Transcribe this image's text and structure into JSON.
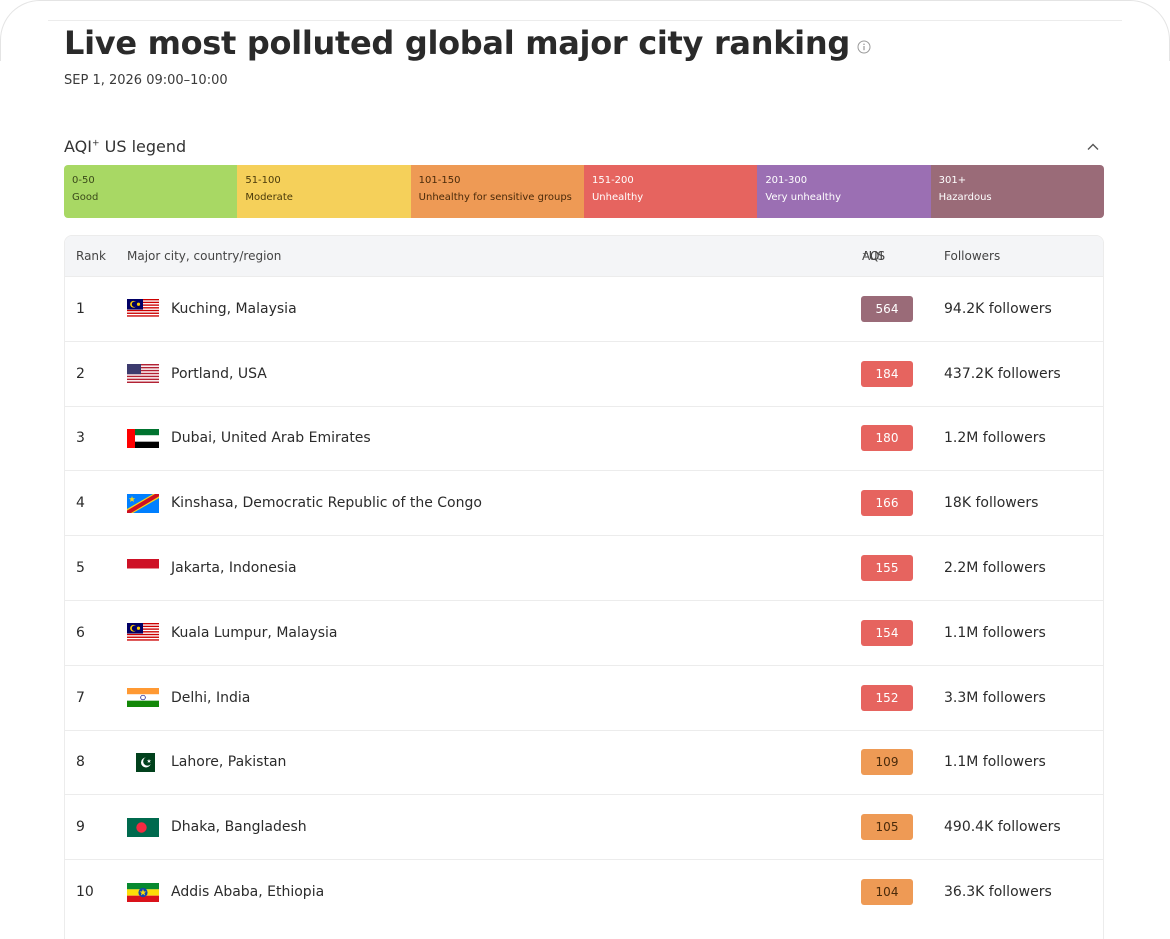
{
  "page": {
    "title": "Live most polluted global major city ranking",
    "timestamp": "SEP 1, 2026 09:00–10:00"
  },
  "icons": {
    "info": "info-icon",
    "collapse": "chevron-up-icon"
  },
  "legend": {
    "title": "AQI",
    "title_sup": "+",
    "title_suffix": " US legend",
    "segments": [
      {
        "range": "0-50",
        "label": "Good",
        "color": "#a8d864",
        "text_color": "#3a4a1a"
      },
      {
        "range": "51-100",
        "label": "Moderate",
        "color": "#f5d05a",
        "text_color": "#4a3a0a"
      },
      {
        "range": "101-150",
        "label": "Unhealthy for sensitive groups",
        "color": "#ee9a55",
        "text_color": "#4a2a0a"
      },
      {
        "range": "151-200",
        "label": "Unhealthy",
        "color": "#e6645f",
        "text_color": "#ffffff"
      },
      {
        "range": "201-300",
        "label": "Very unhealthy",
        "color": "#9b6fb3",
        "text_color": "#ffffff"
      },
      {
        "range": "301+",
        "label": "Hazardous",
        "color": "#9a6b78",
        "text_color": "#ffffff"
      }
    ]
  },
  "table": {
    "headers": {
      "rank": "Rank",
      "city": "Major city, country/region",
      "aqi": "AQI",
      "aqi_sup": "+",
      "aqi_suffix": " US",
      "followers": "Followers"
    },
    "rows": [
      {
        "rank": "1",
        "flag": "malaysia-flag-icon",
        "city": "Kuching, Malaysia",
        "aqi": "564",
        "aqi_color": "#9a6b78",
        "followers": "94.2K followers"
      },
      {
        "rank": "2",
        "flag": "usa-flag-icon",
        "city": "Portland, USA",
        "aqi": "184",
        "aqi_color": "#e6645f",
        "followers": "437.2K followers"
      },
      {
        "rank": "3",
        "flag": "uae-flag-icon",
        "city": "Dubai, United Arab Emirates",
        "aqi": "180",
        "aqi_color": "#e6645f",
        "followers": "1.2M followers"
      },
      {
        "rank": "4",
        "flag": "drc-flag-icon",
        "city": "Kinshasa, Democratic Republic of the Congo",
        "aqi": "166",
        "aqi_color": "#e6645f",
        "followers": "18K followers"
      },
      {
        "rank": "5",
        "flag": "indonesia-flag-icon",
        "city": "Jakarta, Indonesia",
        "aqi": "155",
        "aqi_color": "#e6645f",
        "followers": "2.2M followers"
      },
      {
        "rank": "6",
        "flag": "malaysia-flag-icon",
        "city": "Kuala Lumpur, Malaysia",
        "aqi": "154",
        "aqi_color": "#e6645f",
        "followers": "1.1M followers"
      },
      {
        "rank": "7",
        "flag": "india-flag-icon",
        "city": "Delhi, India",
        "aqi": "152",
        "aqi_color": "#e6645f",
        "followers": "3.3M followers"
      },
      {
        "rank": "8",
        "flag": "pakistan-flag-icon",
        "city": "Lahore, Pakistan",
        "aqi": "109",
        "aqi_color": "#ee9a55",
        "followers": "1.1M followers"
      },
      {
        "rank": "9",
        "flag": "bangladesh-flag-icon",
        "city": "Dhaka, Bangladesh",
        "aqi": "105",
        "aqi_color": "#ee9a55",
        "followers": "490.4K followers"
      },
      {
        "rank": "10",
        "flag": "ethiopia-flag-icon",
        "city": "Addis Ababa, Ethiopia",
        "aqi": "104",
        "aqi_color": "#ee9a55",
        "followers": "36.3K followers"
      }
    ]
  }
}
